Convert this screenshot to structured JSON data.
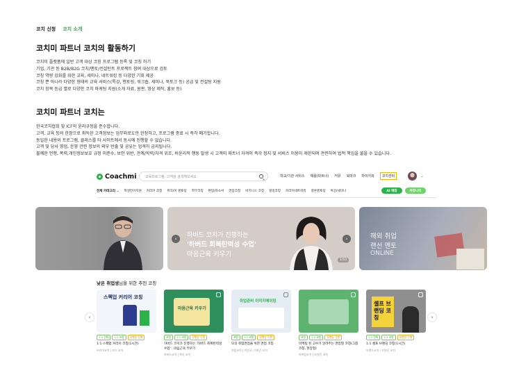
{
  "tabs": {
    "active": "코치 신청",
    "inactive": "코치 소개"
  },
  "section1": {
    "title": "코치미 파트너 코치의 활동하기",
    "lines": [
      "코치미 플랫폼에 일반 고객 대상 코칭 프로그램 등록 및 코칭 하기",
      "기업, 기관 등 B2B/B2G 코치/멘토/컨설턴트 프로젝트 참여 대상으로 검토",
      "코칭 역량 강화를 위한 교육, 세미나, 네트워킹 등 다양한 기회 제공",
      "코칭 뿐 아니라 다양한 형태의 교육 서비스(특강, 멘토링, 워크숍, 세미나, 북토크 등) 공급 및 컨설팅 지원",
      "코치 항목 등급 별로 다양한 코치 마케팅 지원(소개 자료, 원판, 영상 제작, 홍보 등)"
    ]
  },
  "section2": {
    "title": "코치미 파트너 코치는",
    "lines": [
      "한국코치협회 및 ICF의 윤리규정을 준수합니다.",
      "고객, 교육 등의 한정으로 취득한 고객정보는 업무외로도만 한정하고, 프로그램 종료 시 즉각 폐기합니다.",
      "동일한 내용의 프로그램, 클래스를 타 사이트에서 동시에 진행할 수 없습니다.",
      "고객 및 당사 영업, 운영 관련 정보의 외부 반출 및 공유는 엄격히 금지됩니다.",
      "불쾌한 언행, 폭력,개인정보보호 규정 미준수, 보안 위반, 관계/학력/자격 위조, 비윤리적 행동 발생 시 고객미 파트너 자격이 즉각 정지 및 서비스 이용이 제한되며 관련하여 법적 책임을 물을 수 있습니다."
    ]
  },
  "site": {
    "logo": "Coachmi",
    "search_placeholder": "교육프로그램, 고객을 검색해보세요",
    "nav": [
      "학교/기관 서비스",
      "채용(파트너)",
      "커뮤",
      "북마크",
      "마이키와",
      "코치센터"
    ],
    "categories": [
      "전체 카테고리",
      "학생전이지원",
      "커리어 코칭",
      "취직/이 멘토링",
      "학부코칭",
      "편입/자소서",
      "연봉코칭",
      "비지니스 코칭",
      "힐링코칭",
      "커리어네트워킹",
      "결혼멘토링",
      "특강/세미나"
    ],
    "pill_ai": "AI 매칭",
    "pill_free": "커뮤니티"
  },
  "banners": {
    "middle": {
      "line1": "하버드 코치가 진행하는",
      "line2": "'하버드 회복탄력성 수업'",
      "line3": "마음근육 키우기",
      "counter": "1/10"
    },
    "right": {
      "line1": "해외 취업",
      "line2": "랜선 멘토",
      "line3": "ONLINE"
    }
  },
  "recommend": {
    "title_bold": "낯은 취업생",
    "title_rest": "님을 위한 추천 코칭",
    "cards": [
      {
        "thumb_text": "스펙업 커리어 코칭",
        "tags": [
          "1:1 전화",
          "1:1 코칭",
          "실행방 진행"
        ],
        "title": "1:1 스펙업 커리어 코칭(1시간)",
        "meta": "커리어코치 | 조이 코치"
      },
      {
        "thumb_text": "마음근육 키우기",
        "tags": [
          "코칭",
          "1:1 코칭",
          "실행방 진행"
        ],
        "title": "하버드 코치가 진행하는 '하버드 회복탄력성\n수업' : 마음근육 키우기",
        "meta": "하버드코치 | 최다 코치"
      },
      {
        "thumb_text": "취업준비 이미지메이킹",
        "tags": [
          "코칭",
          "1:1 코칭",
          "실행방 진행"
        ],
        "title": "모의 취업면접을 위한 면접 코칭",
        "meta": "면접코치 | 박원규, 이희건 코치"
      },
      {
        "thumb_text": "",
        "tags": [
          "코칭",
          "1:1 코칭",
          "실행방 진행"
        ],
        "title": "마케팅 된 고수가 알려주는 면접형 코칭(그룹\n코칭, 현장형)",
        "meta": "마케팅코치 | 조원진 코치"
      },
      {
        "thumb_text": "셀프 브랜딩 코칭",
        "tags": [
          "1:1 전화",
          "1:1 코칭",
          "실행방 진행"
        ],
        "title": "1:1 셀프 브랜딩 코칭(1시간)",
        "meta": "브랜드코치 | 조원진 코치"
      }
    ]
  },
  "colors": {
    "brand": "#2bb34a",
    "highlight": "#f5b300"
  }
}
